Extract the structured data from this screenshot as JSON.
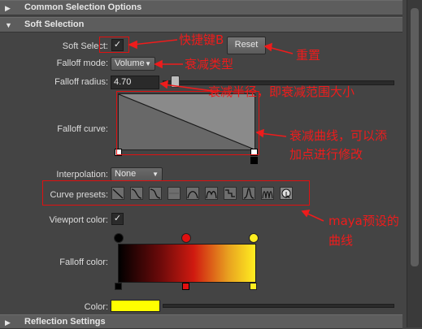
{
  "sections": {
    "common": {
      "title": "Common Selection Options",
      "arrow": "▶"
    },
    "soft": {
      "title": "Soft Selection",
      "arrow": "▼"
    },
    "reflection": {
      "title": "Reflection Settings",
      "arrow": "▶"
    }
  },
  "soft_select": {
    "label": "Soft Select:",
    "checked": "✓"
  },
  "reset_button": {
    "label": "Reset"
  },
  "falloff_mode": {
    "label": "Falloff mode:",
    "value": "Volume"
  },
  "falloff_radius": {
    "label": "Falloff radius:",
    "value": "4.70",
    "slider_fraction": 0.04
  },
  "falloff_curve": {
    "label": "Falloff curve:"
  },
  "interpolation": {
    "label": "Interpolation:",
    "value": "None"
  },
  "curve_presets": {
    "label": "Curve presets:"
  },
  "viewport_color": {
    "label": "Viewport color:",
    "checked": "✓"
  },
  "falloff_color": {
    "label": "Falloff color:",
    "gradient_colors": [
      "#000000",
      "#cc1010",
      "#ffee20"
    ]
  },
  "color": {
    "label": "Color:",
    "swatch": "#ffff00"
  },
  "annotations": {
    "shortcut": "快捷键B",
    "reset": "重置",
    "falloff_type": "衰减类型",
    "falloff_radius": "衰减半径，即衰减范围大小",
    "curve_line1": "衰减曲线，可以添",
    "curve_line2": "加点进行修改",
    "presets_line1": "maya预设的",
    "presets_line2": "曲线",
    "color": "#ee1c1c"
  }
}
